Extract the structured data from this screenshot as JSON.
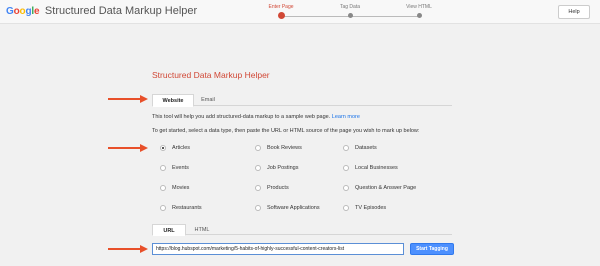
{
  "header": {
    "logo_letters": [
      "G",
      "o",
      "o",
      "g",
      "l",
      "e"
    ],
    "product_name": "Structured Data Markup Helper",
    "steps": [
      {
        "label": "Enter Page",
        "active": true
      },
      {
        "label": "Tag Data",
        "active": false
      },
      {
        "label": "View HTML",
        "active": false
      }
    ],
    "help_label": "Help"
  },
  "main": {
    "title": "Structured Data Markup Helper",
    "tabs": [
      {
        "label": "Website",
        "active": true
      },
      {
        "label": "Email",
        "active": false
      }
    ],
    "intro_text": "This tool will help you add structured-data markup to a sample web page.",
    "learn_more": "Learn more",
    "instruction": "To get started, select a data type, then paste the URL or HTML source of the page you wish to mark up below:",
    "data_types": [
      {
        "label": "Articles",
        "checked": true
      },
      {
        "label": "Book Reviews",
        "checked": false
      },
      {
        "label": "Datasets",
        "checked": false
      },
      {
        "label": "Events",
        "checked": false
      },
      {
        "label": "Job Postings",
        "checked": false
      },
      {
        "label": "Local Businesses",
        "checked": false
      },
      {
        "label": "Movies",
        "checked": false
      },
      {
        "label": "Products",
        "checked": false
      },
      {
        "label": "Question & Answer Page",
        "checked": false
      },
      {
        "label": "Restaurants",
        "checked": false
      },
      {
        "label": "Software Applications",
        "checked": false
      },
      {
        "label": "TV Episodes",
        "checked": false
      }
    ],
    "source_tabs": [
      {
        "label": "URL",
        "active": true
      },
      {
        "label": "HTML",
        "active": false
      }
    ],
    "url_value": "https://blog.hubspot.com/marketing/5-habits-of-highly-successful-content-creators-list",
    "start_button": "Start Tagging"
  },
  "colors": {
    "accent_red": "#d14836",
    "arrow": "#e8502a",
    "button_blue": "#4d90fe",
    "link": "#1a73e8"
  }
}
